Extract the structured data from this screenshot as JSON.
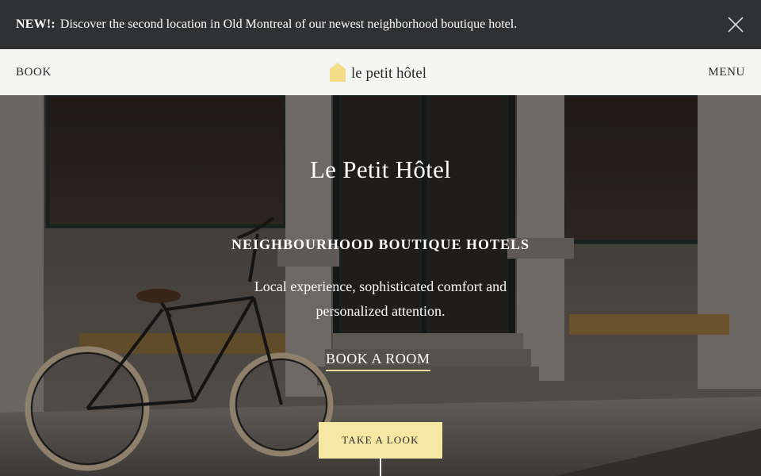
{
  "announcement": {
    "badge": "NEW!:",
    "message": "Discover the second location in Old Montreal of our newest neighborhood boutique hotel."
  },
  "header": {
    "book_label": "BOOK",
    "menu_label": "MENU",
    "logo_text": "le petit hôtel"
  },
  "hero": {
    "title": "Le Petit Hôtel",
    "kicker": "NEIGHBOURHOOD BOUTIQUE HOTELS",
    "description": "Local experience, sophisticated comfort and personalized attention.",
    "cta_label": "BOOK A ROOM",
    "look_button_label": "TAKE A LOOK"
  },
  "colors": {
    "accent_yellow": "#f7e7a4",
    "announcement_bg": "#303132",
    "header_bg": "#f5f5f3"
  },
  "icons": [
    "close-icon",
    "hotel-logo-icon"
  ]
}
